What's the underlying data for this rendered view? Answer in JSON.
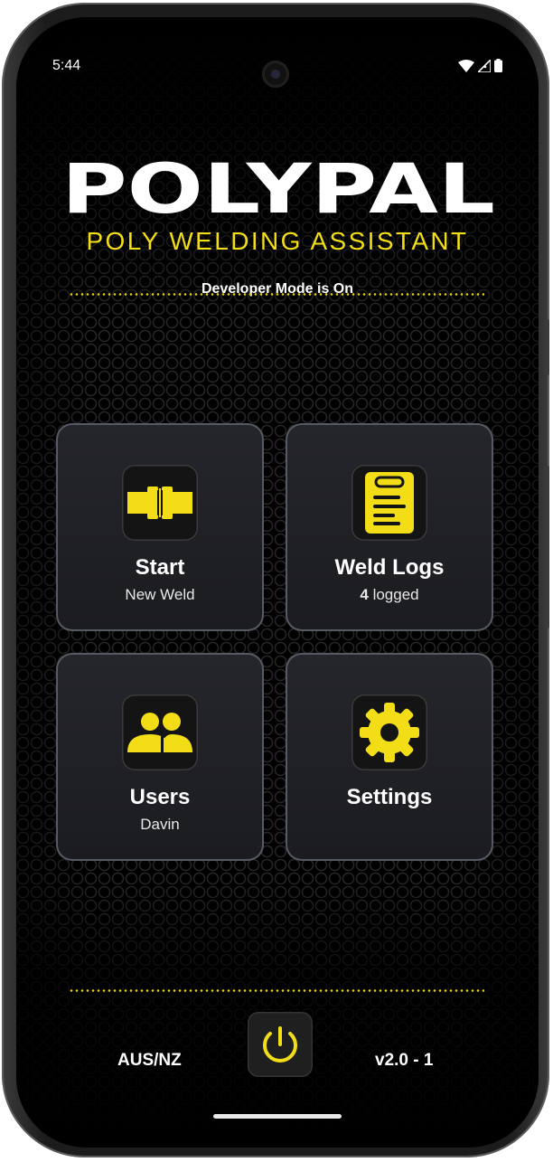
{
  "status_bar": {
    "time": "5:44",
    "wifi_icon": "wifi-icon",
    "signal_icon": "cell-signal-icon",
    "battery_icon": "battery-icon"
  },
  "brand": {
    "name": "POLYPAL",
    "subtitle": "POLY WELDING ASSISTANT",
    "accent_color": "#F2DD17"
  },
  "notice": "Developer Mode is On",
  "tiles": [
    {
      "title": "Start",
      "subtitle": "New Weld",
      "icon": "pipe-coupler-icon"
    },
    {
      "title": "Weld Logs",
      "count": "4",
      "subtitle": "logged",
      "icon": "clipboard-list-icon"
    },
    {
      "title": "Users",
      "subtitle": "Davin",
      "icon": "users-icon"
    },
    {
      "title": "Settings",
      "subtitle": "",
      "icon": "gear-icon"
    }
  ],
  "footer": {
    "region": "AUS/NZ",
    "power_icon": "power-icon",
    "version": "v2.0 - 1"
  }
}
